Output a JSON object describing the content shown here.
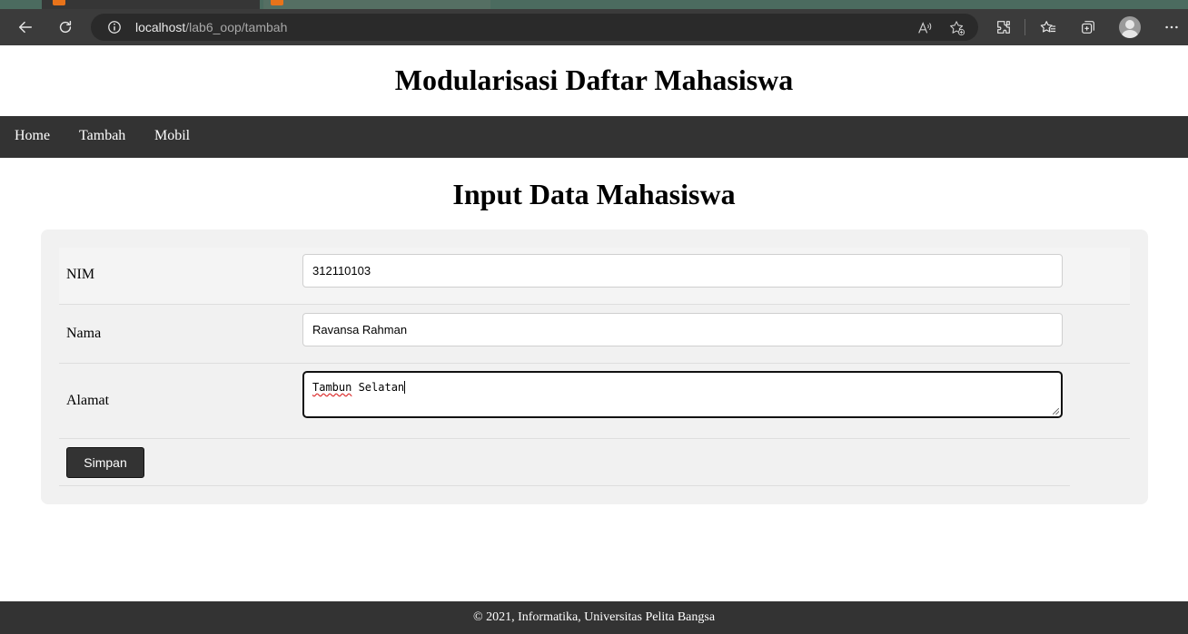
{
  "browser": {
    "url_host": "localhost",
    "url_path": "/lab6_oop/tambah",
    "icons": {
      "back": "back-arrow-icon",
      "refresh": "refresh-icon",
      "site_info": "info-icon",
      "read_aloud": "read-aloud-icon",
      "favorite_add": "add-favorite-icon",
      "extensions": "extensions-icon",
      "favorites": "favorites-icon",
      "collections": "collections-icon",
      "profile": "profile-icon",
      "more": "more-icon"
    }
  },
  "header": {
    "title": "Modularisasi Daftar Mahasiswa"
  },
  "nav": {
    "items": [
      {
        "label": "Home"
      },
      {
        "label": "Tambah"
      },
      {
        "label": "Mobil"
      }
    ]
  },
  "form": {
    "title": "Input Data Mahasiswa",
    "fields": [
      {
        "label": "NIM",
        "value": "312110103"
      },
      {
        "label": "Nama",
        "value": "Ravansa Rahman"
      },
      {
        "label": "Alamat",
        "value_word1": "Tambun",
        "value_rest": " Selatan"
      }
    ],
    "submit_label": "Simpan"
  },
  "footer": {
    "text": "© 2021, Informatika, Universitas Pelita Bangsa"
  },
  "colors": {
    "navbar": "#333333",
    "footer": "#333333",
    "card": "#f1f1f1",
    "button": "#333333"
  }
}
